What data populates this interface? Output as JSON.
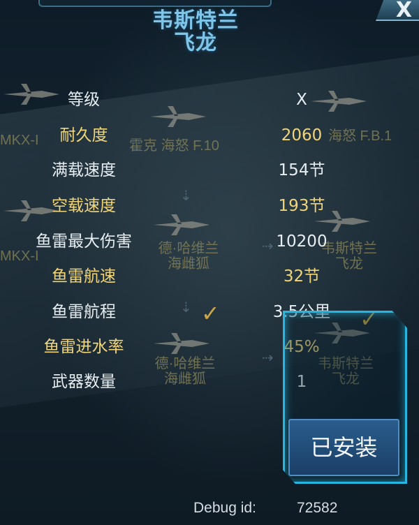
{
  "header": {
    "title_line1": "韦斯特兰",
    "title_line2": "飞龙",
    "close_label": "X"
  },
  "background_planes": [
    {
      "label": "MKX-I"
    },
    {
      "label": "霍克 海怒 F.10"
    },
    {
      "label": "海怒 F.B.1"
    },
    {
      "label": "MKX-I"
    },
    {
      "label": "德·哈维兰\n海雌狐"
    },
    {
      "label": "韦斯特兰\n飞龙"
    },
    {
      "label": "德·哈维兰\n海雌狐"
    },
    {
      "label": "韦斯特兰\n飞龙"
    }
  ],
  "stats": [
    {
      "label": "等级",
      "value": "X",
      "color": "white"
    },
    {
      "label": "耐久度",
      "value": "2060",
      "color": "gold"
    },
    {
      "label": "满载速度",
      "value": "154节",
      "color": "white"
    },
    {
      "label": "空载速度",
      "value": "193节",
      "color": "gold"
    },
    {
      "label": "鱼雷最大伤害",
      "value": "10200",
      "color": "white"
    },
    {
      "label": "鱼雷航速",
      "value": "32节",
      "color": "gold"
    },
    {
      "label": "鱼雷航程",
      "value": "3.5公里",
      "color": "white"
    },
    {
      "label": "鱼雷进水率",
      "value": "45%",
      "color": "gold"
    },
    {
      "label": "武器数量",
      "value": "1",
      "color": "white"
    }
  ],
  "installed_button": {
    "label": "已安装"
  },
  "debug": {
    "label": "Debug id:",
    "value": "72582"
  },
  "colors": {
    "gold": "#f0d57a",
    "white": "#e7eef2",
    "accent": "#27b6e0",
    "title": "#7fc5ea"
  }
}
